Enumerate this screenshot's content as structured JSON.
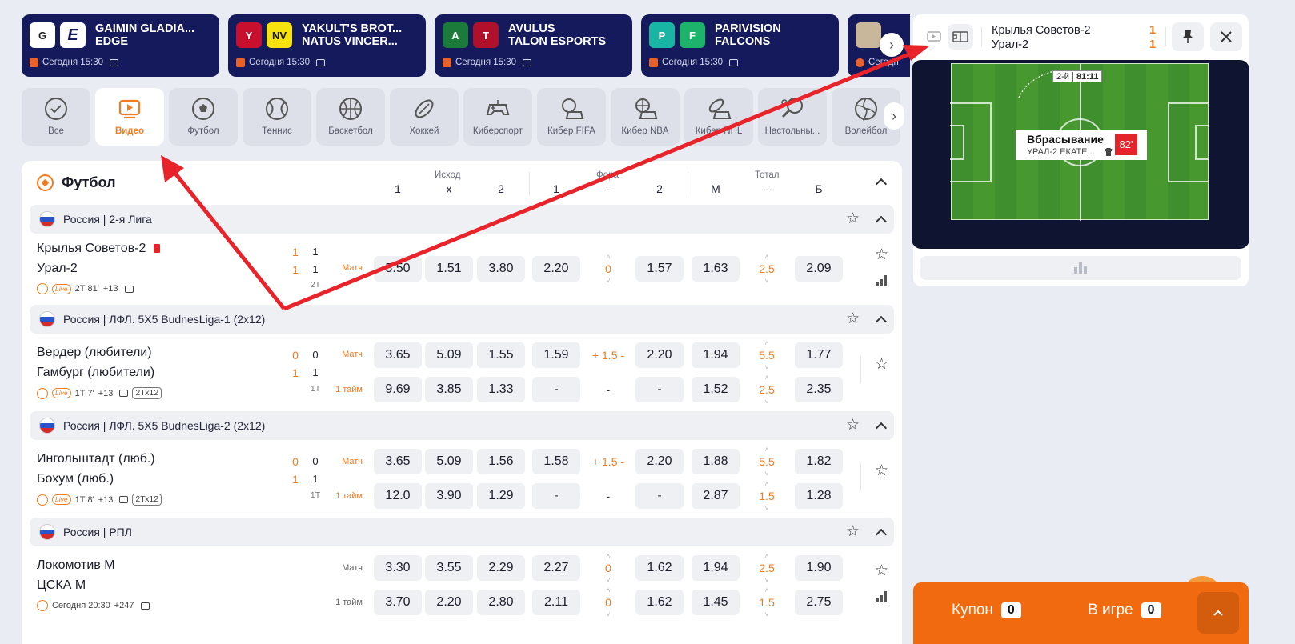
{
  "match_cards": [
    {
      "team1": "GAIMIN GLADIA...",
      "team2": "EDGE",
      "logo1": "G",
      "logo2": "E",
      "time": "Сегодня 15:30"
    },
    {
      "team1": "YAKULT'S BROT...",
      "team2": "NATUS VINCER...",
      "logo1": "Y",
      "logo2": "NV",
      "time": "Сегодня 15:30"
    },
    {
      "team1": "AVULUS",
      "team2": "TALON ESPORTS",
      "logo1": "A",
      "logo2": "T",
      "time": "Сегодня 15:30"
    },
    {
      "team1": "PARIVISION",
      "team2": "FALCONS",
      "logo1": "P",
      "logo2": "F",
      "time": "Сегодня 15:30"
    },
    {
      "team1": "",
      "team2": "",
      "logo1": "",
      "logo2": "",
      "time": "Сегодн"
    }
  ],
  "sports": [
    {
      "label": "Все",
      "icon": "check-circle-icon",
      "active": false
    },
    {
      "label": "Видео",
      "icon": "video-icon",
      "active": true
    },
    {
      "label": "Футбол",
      "icon": "football-icon",
      "active": false
    },
    {
      "label": "Теннис",
      "icon": "tennis-icon",
      "active": false
    },
    {
      "label": "Баскетбол",
      "icon": "basketball-icon",
      "active": false
    },
    {
      "label": "Хоккей",
      "icon": "hockey-icon",
      "active": false
    },
    {
      "label": "Киберспорт",
      "icon": "gamepad-icon",
      "active": false
    },
    {
      "label": "Кибер FIFA",
      "icon": "cyber-fifa-icon",
      "active": false
    },
    {
      "label": "Кибер NBA",
      "icon": "cyber-nba-icon",
      "active": false
    },
    {
      "label": "Кибер NHL",
      "icon": "cyber-nhl-icon",
      "active": false
    },
    {
      "label": "Настольны...",
      "icon": "table-tennis-icon",
      "active": false
    },
    {
      "label": "Волейбол",
      "icon": "volleyball-icon",
      "active": false
    }
  ],
  "section": {
    "title": "Футбол",
    "groups": [
      "Исход",
      "Фора",
      "Тотал"
    ],
    "columns": [
      "1",
      "x",
      "2",
      "1",
      "-",
      "2",
      "М",
      "-",
      "Б"
    ]
  },
  "leagues": [
    {
      "name": "Россия | 2-я Лига"
    },
    {
      "name": "Россия | ЛФЛ. 5Х5 BudnesLiga-1 (2x12)"
    },
    {
      "name": "Россия | ЛФЛ. 5Х5 BudnesLiga-2 (2x12)"
    },
    {
      "name": "Россия | РПЛ"
    }
  ],
  "matches": [
    {
      "team1": "Крылья Советов-2",
      "team2": "Урал-2",
      "red_card": true,
      "meta": {
        "live": "Live",
        "time": "2Т 81'",
        "more": "+13",
        "format": ""
      },
      "score_main": [
        "1",
        "1"
      ],
      "score_cur": [
        "1",
        "1"
      ],
      "period": "2Т",
      "rows": [
        {
          "market": "Матч",
          "odds": [
            "5.50",
            "1.51",
            "3.80",
            "2.20",
            "0",
            "1.57",
            "1.63",
            "2.5",
            "2.09"
          ]
        }
      ]
    },
    {
      "team1": "Вердер (любители)",
      "team2": "Гамбург (любители)",
      "meta": {
        "live": "Live",
        "time": "1Т 7'",
        "more": "+13",
        "format": "2Тх12"
      },
      "score_main": [
        "0",
        "1"
      ],
      "score_cur": [
        "0",
        "1"
      ],
      "period": "1Т",
      "rows": [
        {
          "market": "Матч",
          "odds": [
            "3.65",
            "5.09",
            "1.55",
            "1.59",
            "+ 1.5 -",
            "2.20",
            "1.94",
            "5.5",
            "1.77"
          ]
        },
        {
          "market": "1 тайм",
          "odds": [
            "9.69",
            "3.85",
            "1.33",
            "-",
            "-",
            "-",
            "1.52",
            "2.5",
            "2.35"
          ]
        }
      ]
    },
    {
      "team1": "Ингольштадт (люб.)",
      "team2": "Бохум (люб.)",
      "meta": {
        "live": "Live",
        "time": "1Т 8'",
        "more": "+13",
        "format": "2Тх12"
      },
      "score_main": [
        "0",
        "1"
      ],
      "score_cur": [
        "0",
        "1"
      ],
      "period": "1Т",
      "rows": [
        {
          "market": "Матч",
          "odds": [
            "3.65",
            "5.09",
            "1.56",
            "1.58",
            "+ 1.5 -",
            "2.20",
            "1.88",
            "5.5",
            "1.82"
          ]
        },
        {
          "market": "1 тайм",
          "odds": [
            "12.0",
            "3.90",
            "1.29",
            "-",
            "-",
            "-",
            "2.87",
            "1.5",
            "1.28"
          ]
        }
      ]
    },
    {
      "team1": "Локомотив М",
      "team2": "ЦСКА М",
      "meta": {
        "time": "Сегодня 20:30",
        "more": "+247"
      },
      "rows": [
        {
          "market": "Матч",
          "odds": [
            "3.30",
            "3.55",
            "2.29",
            "2.27",
            "0",
            "1.62",
            "1.94",
            "2.5",
            "1.90"
          ]
        },
        {
          "market": "1 тайм",
          "odds": [
            "3.70",
            "2.20",
            "2.80",
            "2.11",
            "0",
            "1.62",
            "1.45",
            "1.5",
            "2.75"
          ]
        }
      ]
    }
  ],
  "live_panel": {
    "team1": "Крылья Советов-2",
    "team2": "Урал-2",
    "score1": "1",
    "score2": "1",
    "half": "2-й",
    "clock": "81:11",
    "event_title": "Вбрасывание",
    "event_team": "УРАЛ-2 ЕКАТЕ...",
    "event_minute": "82'"
  },
  "coupon": {
    "label": "Купон",
    "count": "0",
    "ingame_label": "В игре",
    "ingame_count": "0"
  },
  "colors": {
    "accent": "#f47c20",
    "navy": "#141a5c",
    "arrow": "#e8232a"
  }
}
